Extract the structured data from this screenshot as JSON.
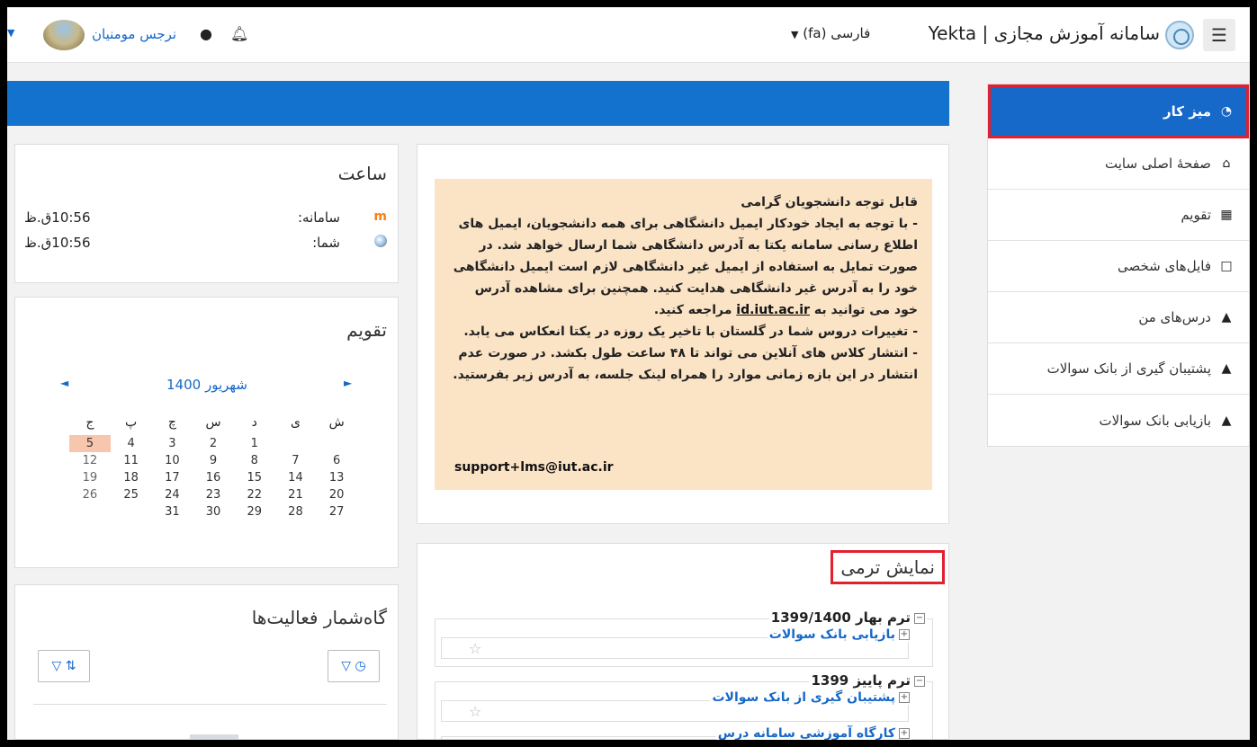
{
  "navbar": {
    "site_name": "سامانه آموزش مجازی | Yekta",
    "language": "فارسی (fa)",
    "user_name": "نرجس مومنیان"
  },
  "side_nav": {
    "items": [
      {
        "label": "میز کار",
        "icon": "dashboard-icon"
      },
      {
        "label": "صفحهٔ اصلی سایت",
        "icon": "home-icon"
      },
      {
        "label": "تقویم",
        "icon": "calendar-icon"
      },
      {
        "label": "فایل‌های شخصی",
        "icon": "file-icon"
      },
      {
        "label": "درس‌های من",
        "icon": "graduation-cap-icon"
      },
      {
        "label": "پشتیبان گیری از بانک سوالات",
        "icon": "graduation-cap-icon"
      },
      {
        "label": "بازیابی بانک سوالات",
        "icon": "graduation-cap-icon"
      }
    ]
  },
  "notice": {
    "line1": "قابل توجه دانشجویان گرامی",
    "line2": "- با توجه به ایجاد خودکار ایمیل دانشگاهی برای همه دانشجویان، ایمیل های اطلاع رسانی سامانه یکتا به آدرس دانشگاهی شما ارسال خواهد شد. در صورت تمایل به استفاده از ایمیل غیر دانشگاهی لازم است ایمیل دانشگاهی خود را به آدرس غیر دانشگاهی هدایت کنید. همچنین برای مشاهده آدرس خود می توانید به",
    "link": "id.iut.ac.ir",
    "line2_end": "مراجعه کنید.",
    "line3": "- تغییرات دروس شما در گلستان با تاخیر یک روزه در یکتا انعکاس می یابد.",
    "line4": "- انتشار کلاس های آنلاین می تواند تا ۴۸ ساعت طول بکشد. در صورت عدم انتشار در این بازه زمانی موارد را همراه لینک جلسه، به آدرس زیر بفرستید.",
    "email": "support+lms@iut.ac.ir"
  },
  "terms": {
    "title": "نمایش ترمی",
    "groups": [
      {
        "name": "ترم بهار 1399/1400",
        "courses": [
          "بازیابی بانک سوالات"
        ]
      },
      {
        "name": "ترم پاییز 1399",
        "courses": [
          "پشتیبان گیری از بانک سوالات",
          "کارگاه آموزشی سامانه درس"
        ]
      }
    ]
  },
  "clock": {
    "title": "ساعت",
    "system_label": "سامانه:",
    "system_time": "10:56ق.ظ",
    "you_label": "شما:",
    "you_time": "10:56ق.ظ"
  },
  "calendar": {
    "title": "تقویم",
    "month": "شهریور 1400",
    "weekdays": [
      "ش",
      "ی",
      "د",
      "س",
      "چ",
      "پ",
      "ج"
    ],
    "weeks": [
      [
        "",
        "",
        "1",
        "2",
        "3",
        "4",
        "5"
      ],
      [
        "6",
        "7",
        "8",
        "9",
        "10",
        "11",
        "12"
      ],
      [
        "13",
        "14",
        "15",
        "16",
        "17",
        "18",
        "19"
      ],
      [
        "20",
        "21",
        "22",
        "23",
        "24",
        "25",
        "26"
      ],
      [
        "27",
        "28",
        "29",
        "30",
        "31",
        "",
        ""
      ]
    ],
    "today": "5"
  },
  "activities": {
    "title": "گاه‌شمار فعالیت‌ها"
  },
  "colors": {
    "accent": "#1668c9",
    "highlight_border": "#e2202e",
    "notice_bg": "#fbe3c5",
    "today_bg": "#f7c6ad"
  }
}
